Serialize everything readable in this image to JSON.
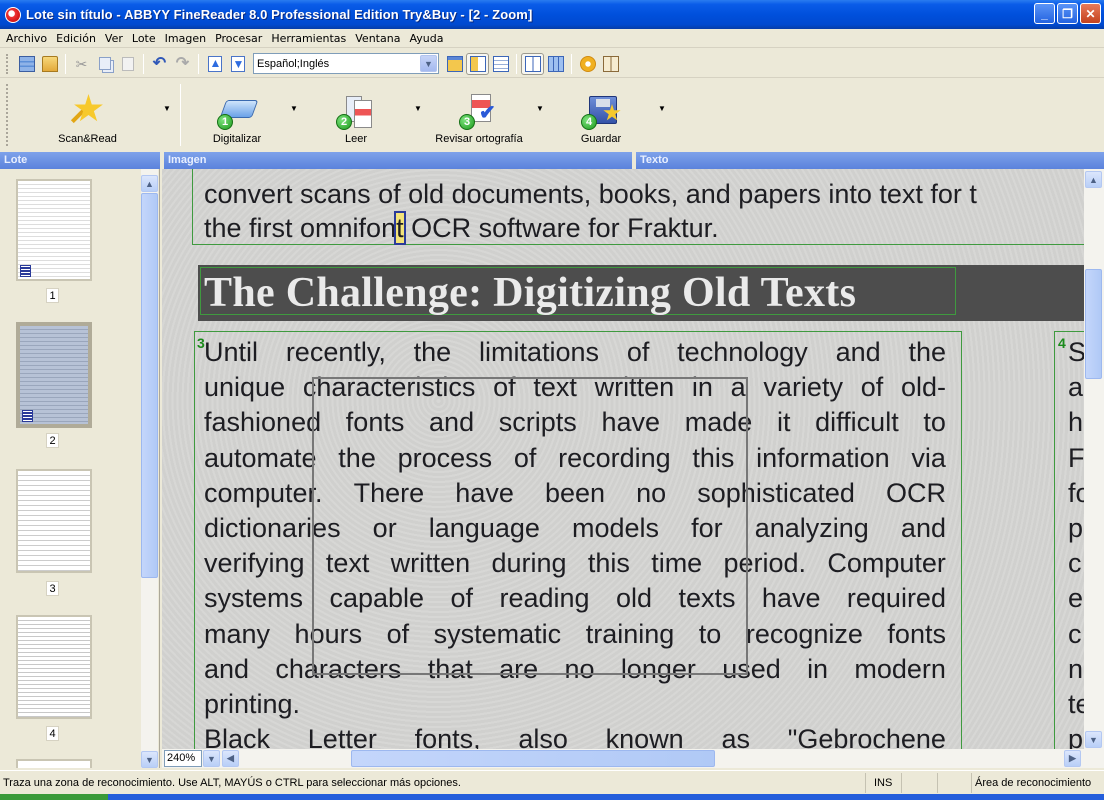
{
  "window": {
    "title": "Lote sin título - ABBYY FineReader 8.0 Professional Edition Try&Buy - [2 - Zoom]",
    "minimize_icon": "minimize-icon",
    "restore_icon": "restore-icon",
    "close_icon": "close-icon"
  },
  "menu": [
    "Archivo",
    "Edición",
    "Ver",
    "Lote",
    "Imagen",
    "Procesar",
    "Herramientas",
    "Ventana",
    "Ayuda"
  ],
  "toolbar": {
    "language_value": "Español;Inglés",
    "icons": [
      "new-batch-icon",
      "open-batch-icon",
      "cut-icon",
      "copy-icon",
      "paste-icon",
      "undo-icon",
      "redo-icon",
      "previous-page-icon",
      "next-page-icon",
      "image-view-icon",
      "image-text-view-icon",
      "text-view-icon",
      "two-page-icon",
      "table-icon",
      "options-gear-icon",
      "dictionary-book-icon"
    ]
  },
  "main_toolbar": {
    "buttons": [
      {
        "label": "Scan&Read",
        "icon": "scan-read-star-icon"
      },
      {
        "label": "Digitalizar",
        "icon": "scanner-icon",
        "step": "1"
      },
      {
        "label": "Leer",
        "icon": "read-document-icon",
        "step": "2"
      },
      {
        "label": "Revisar ortografía",
        "icon": "spell-check-icon",
        "step": "3"
      },
      {
        "label": "Guardar",
        "icon": "save-floppy-icon",
        "step": "4"
      }
    ]
  },
  "panels": {
    "lote": "Lote",
    "imagen": "Imagen",
    "texto": "Texto"
  },
  "batch": {
    "pages": [
      {
        "number": "1",
        "selected": false
      },
      {
        "number": "2",
        "selected": true
      },
      {
        "number": "3",
        "selected": false
      },
      {
        "number": "4",
        "selected": false
      }
    ]
  },
  "image": {
    "top_zone_lines": [
      "convert scans of old documents, books, and papers into text for t",
      "the first omnifont OCR software for Fraktur."
    ],
    "top_line2_before_cursor": "the first omnifon",
    "top_line2_cursor_char": "t",
    "top_line2_after_cursor": " OCR software for Fraktur.",
    "heading": "The Challenge: Digitizing Old Texts",
    "zone3_number": "3",
    "zone4_number": "4",
    "zone3_lines": [
      "Until recently, the limitations of technology and the",
      "unique characteristics of text written in a variety of old-",
      "fashioned fonts and scripts have made it difficult to",
      "automate the process of recording this information via",
      "computer. There have been no sophisticated OCR",
      "dictionaries or language models for analyzing and",
      "verifying text written during this time period. Computer",
      "systems capable of reading old texts have required",
      "many hours of systematic training to recognize fonts",
      "and characters that are no longer used in modern",
      "printing.",
      "Black Letter fonts, also known as \"Gebrochene"
    ],
    "zone4_letters": [
      "S",
      "a",
      "h",
      "F",
      "fo",
      "p",
      "c",
      "e",
      "c",
      "n",
      "te",
      "p"
    ],
    "zoom_level": "240%"
  },
  "status": {
    "message": "Traza una zona de reconocimiento. Use ALT, MAYÚS o CTRL para seleccionar más opciones.",
    "ins": "INS",
    "area": "Área de reconocimiento"
  }
}
